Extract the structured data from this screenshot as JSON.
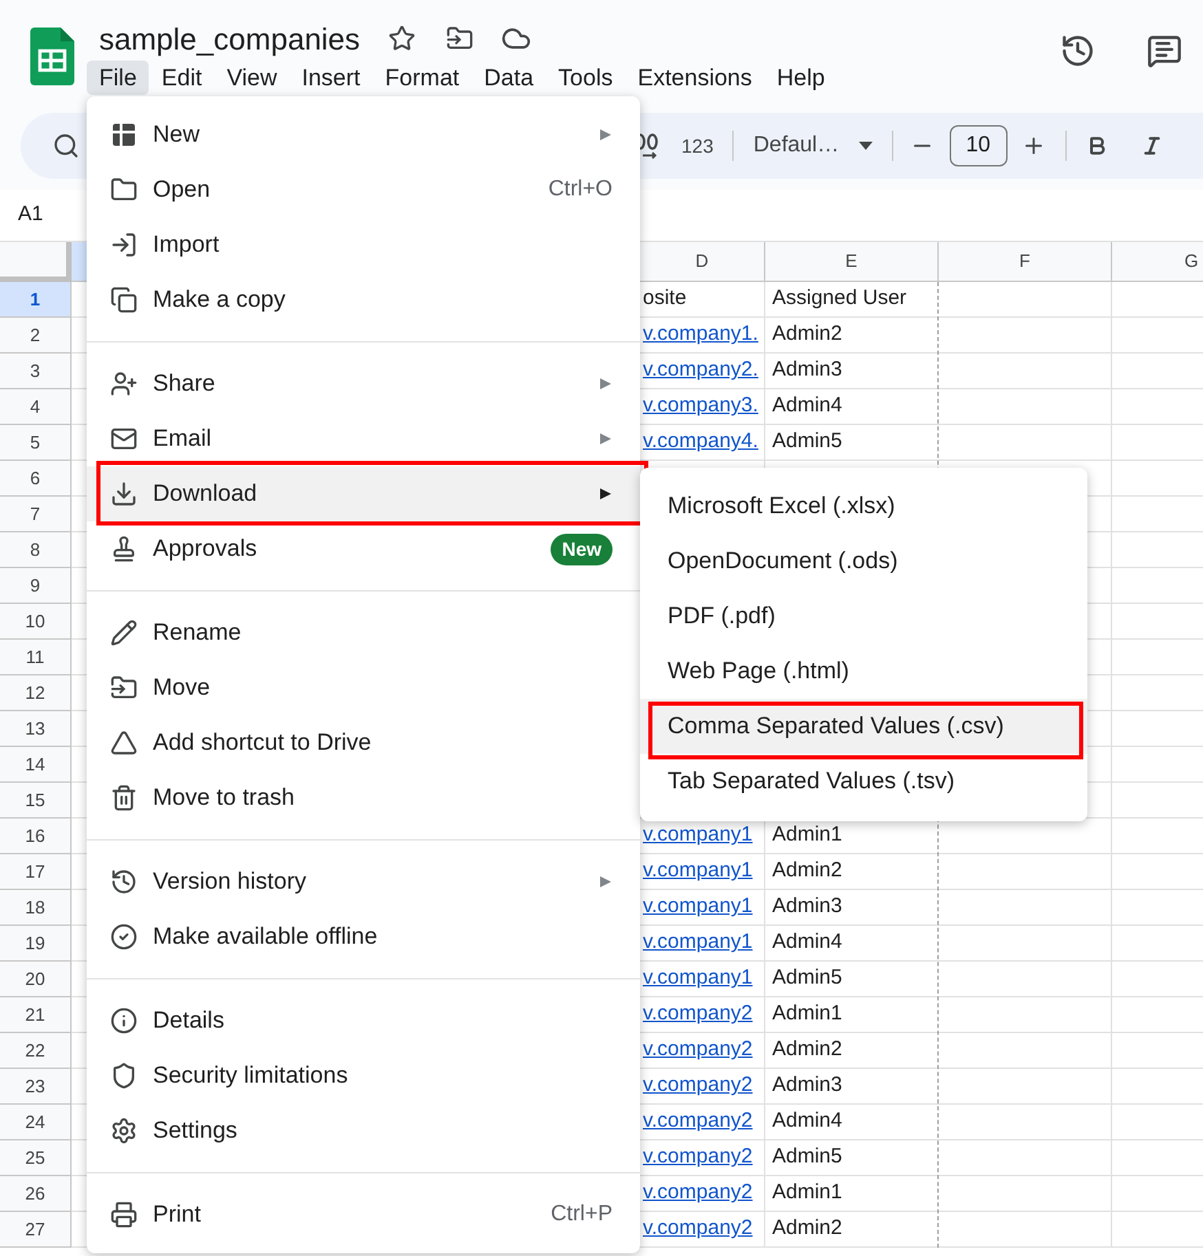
{
  "document": {
    "title": "sample_companies"
  },
  "menubar": [
    {
      "label": "File",
      "selected": true
    },
    {
      "label": "Edit",
      "selected": false
    },
    {
      "label": "View",
      "selected": false
    },
    {
      "label": "Insert",
      "selected": false
    },
    {
      "label": "Format",
      "selected": false
    },
    {
      "label": "Data",
      "selected": false
    },
    {
      "label": "Tools",
      "selected": false
    },
    {
      "label": "Extensions",
      "selected": false
    },
    {
      "label": "Help",
      "selected": false
    }
  ],
  "toolbar": {
    "number_format": "123",
    "font": "Defaul…",
    "font_size": "10"
  },
  "name_box": "A1",
  "grid": {
    "columns": [
      {
        "selected": true
      },
      {
        "label": "D",
        "selected": false
      },
      {
        "label": "E",
        "selected": false
      },
      {
        "label": "F",
        "selected": false
      },
      {
        "label": "G",
        "selected": false
      }
    ],
    "rows": [
      {
        "number": "1",
        "selected": true,
        "d": {
          "text": "osite",
          "kind": "text"
        },
        "e": "Assigned User"
      },
      {
        "number": "2",
        "selected": false,
        "d": {
          "text": "v.company1.",
          "kind": "link"
        },
        "e": "Admin2"
      },
      {
        "number": "3",
        "selected": false,
        "d": {
          "text": "v.company2.",
          "kind": "link"
        },
        "e": "Admin3"
      },
      {
        "number": "4",
        "selected": false,
        "d": {
          "text": "v.company3.",
          "kind": "link"
        },
        "e": "Admin4"
      },
      {
        "number": "5",
        "selected": false,
        "d": {
          "text": "v.company4.",
          "kind": "link"
        },
        "e": "Admin5"
      },
      {
        "number": "6",
        "selected": false
      },
      {
        "number": "7",
        "selected": false
      },
      {
        "number": "8",
        "selected": false
      },
      {
        "number": "9",
        "selected": false
      },
      {
        "number": "10",
        "selected": false
      },
      {
        "number": "11",
        "selected": false
      },
      {
        "number": "12",
        "selected": false
      },
      {
        "number": "13",
        "selected": false
      },
      {
        "number": "14",
        "selected": false
      },
      {
        "number": "15",
        "selected": false
      },
      {
        "number": "16",
        "selected": false,
        "d": {
          "text": "v.company1",
          "kind": "link"
        },
        "e": "Admin1"
      },
      {
        "number": "17",
        "selected": false,
        "d": {
          "text": "v.company1",
          "kind": "link"
        },
        "e": "Admin2"
      },
      {
        "number": "18",
        "selected": false,
        "d": {
          "text": "v.company1",
          "kind": "link"
        },
        "e": "Admin3"
      },
      {
        "number": "19",
        "selected": false,
        "d": {
          "text": "v.company1",
          "kind": "link"
        },
        "e": "Admin4"
      },
      {
        "number": "20",
        "selected": false,
        "d": {
          "text": "v.company1",
          "kind": "link"
        },
        "e": "Admin5"
      },
      {
        "number": "21",
        "selected": false,
        "d": {
          "text": "v.company2",
          "kind": "link"
        },
        "e": "Admin1"
      },
      {
        "number": "22",
        "selected": false,
        "d": {
          "text": "v.company2",
          "kind": "link"
        },
        "e": "Admin2"
      },
      {
        "number": "23",
        "selected": false,
        "d": {
          "text": "v.company2",
          "kind": "link"
        },
        "e": "Admin3"
      },
      {
        "number": "24",
        "selected": false,
        "d": {
          "text": "v.company2",
          "kind": "link"
        },
        "e": "Admin4"
      },
      {
        "number": "25",
        "selected": false,
        "d": {
          "text": "v.company2",
          "kind": "link"
        },
        "e": "Admin5"
      },
      {
        "number": "26",
        "selected": false,
        "d": {
          "text": "v.company2",
          "kind": "link"
        },
        "e": "Admin1"
      },
      {
        "number": "27",
        "selected": false,
        "d": {
          "text": "v.company2",
          "kind": "link"
        },
        "e": "Admin2"
      }
    ]
  },
  "file_menu": {
    "sections": [
      [
        {
          "label": "New",
          "submenu": true,
          "active": false,
          "outlined": false
        },
        {
          "label": "Open",
          "shortcut": "Ctrl+O",
          "submenu": false,
          "active": false,
          "outlined": false
        },
        {
          "label": "Import",
          "submenu": false,
          "active": false,
          "outlined": false
        },
        {
          "label": "Make a copy",
          "submenu": false,
          "active": false,
          "outlined": false
        }
      ],
      [
        {
          "label": "Share",
          "submenu": true,
          "active": false,
          "outlined": false
        },
        {
          "label": "Email",
          "submenu": true,
          "active": false,
          "outlined": false
        },
        {
          "label": "Download",
          "submenu": true,
          "active": true,
          "outlined": true
        },
        {
          "label": "Approvals",
          "badge": "New",
          "submenu": false,
          "active": false,
          "outlined": false
        }
      ],
      [
        {
          "label": "Rename",
          "submenu": false,
          "active": false,
          "outlined": false
        },
        {
          "label": "Move",
          "submenu": false,
          "active": false,
          "outlined": false
        },
        {
          "label": "Add shortcut to Drive",
          "submenu": false,
          "active": false,
          "outlined": false
        },
        {
          "label": "Move to trash",
          "submenu": false,
          "active": false,
          "outlined": false
        }
      ],
      [
        {
          "label": "Version history",
          "submenu": true,
          "active": false,
          "outlined": false
        },
        {
          "label": "Make available offline",
          "submenu": false,
          "active": false,
          "outlined": false
        }
      ],
      [
        {
          "label": "Details",
          "submenu": false,
          "active": false,
          "outlined": false
        },
        {
          "label": "Security limitations",
          "submenu": false,
          "active": false,
          "outlined": false
        },
        {
          "label": "Settings",
          "submenu": false,
          "active": false,
          "outlined": false
        }
      ],
      [
        {
          "label": "Print",
          "shortcut": "Ctrl+P",
          "submenu": false,
          "active": false,
          "outlined": false
        }
      ]
    ]
  },
  "download_submenu": {
    "items": [
      {
        "label": "Microsoft Excel (.xlsx)",
        "active": false,
        "outlined": false
      },
      {
        "label": "OpenDocument (.ods)",
        "active": false,
        "outlined": false
      },
      {
        "label": "PDF (.pdf)",
        "active": false,
        "outlined": false
      },
      {
        "label": "Web Page (.html)",
        "active": false,
        "outlined": false
      },
      {
        "label": "Comma Separated Values (.csv)",
        "active": true,
        "outlined": true
      },
      {
        "label": "Tab Separated Values (.tsv)",
        "active": false,
        "outlined": false
      }
    ]
  }
}
